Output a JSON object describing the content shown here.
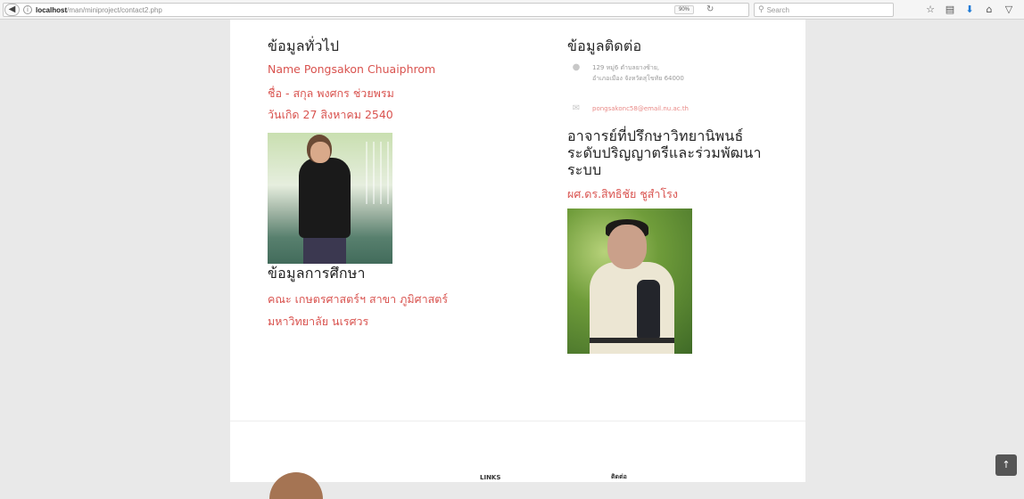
{
  "browser": {
    "url_host": "localhost",
    "url_path": "/man/miniproject/contact2.php",
    "zoom": "90%",
    "search_placeholder": "Search",
    "icons": [
      "back-icon",
      "info-icon",
      "reload-icon",
      "search-icon",
      "bookmark-star-icon",
      "reading-list-icon",
      "download-icon",
      "home-icon",
      "pocket-icon",
      "menu-icon"
    ]
  },
  "general": {
    "heading": "ข้อมูลทั่วไป",
    "name_en": "Name Pongsakon Chuaiphrom",
    "name_th": "ชื่อ - สกุล พงศกร ช่วยพรม",
    "birthday": "วันเกิด 27 สิงหาคม 2540"
  },
  "education": {
    "heading": "ข้อมูลการศึกษา",
    "faculty": "คณะ เกษตรศาสตร์ฯ สาขา ภูมิศาสตร์",
    "university": "มหาวิทยาลัย นเรศวร"
  },
  "contact": {
    "heading": "ข้อมูลติดต่อ",
    "address_line1": "129 หมู่6 ตำบลยางซ้าย,",
    "address_line2": "อำเภอเมือง จังหวัดสุโขทัย 64000",
    "email": "pongsakonc58@email.nu.ac.th"
  },
  "advisor": {
    "heading_line1": "อาจารย์ที่ปรึกษาวิทยานิพนธ์",
    "heading_line2": "ระดับปริญญาตรีและร่วมพัฒนา",
    "heading_line3": "ระบบ",
    "name": "ผศ.ดร.สิทธิชัย ชูสำโรง"
  },
  "footer": {
    "links_label": "LINKS",
    "contact_label": "ติดต่อ"
  },
  "scroll_top_glyph": "↑"
}
